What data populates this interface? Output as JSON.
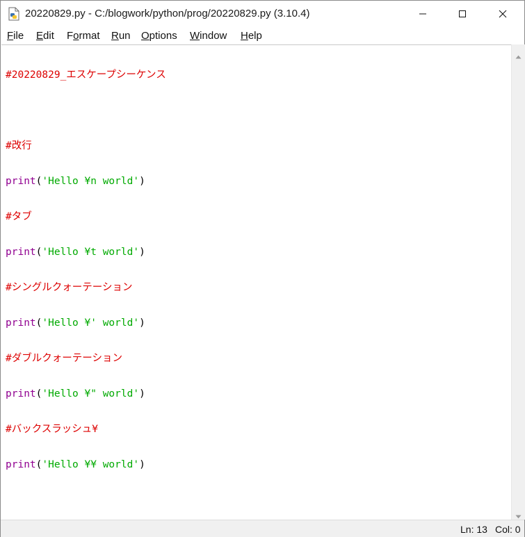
{
  "window": {
    "title": "20220829.py - C:/blogwork/python/prog/20220829.py (3.10.4)",
    "icon": "python-file-icon"
  },
  "menu": {
    "file": {
      "ul": "F",
      "rest": "ile"
    },
    "edit": {
      "ul": "E",
      "rest": "dit"
    },
    "format": {
      "pre": "F",
      "ul": "o",
      "rest": "rmat"
    },
    "run": {
      "ul": "R",
      "rest": "un"
    },
    "options": {
      "ul": "O",
      "rest": "ptions"
    },
    "window": {
      "ul": "W",
      "rest": "indow"
    },
    "help": {
      "ul": "H",
      "rest": "elp"
    }
  },
  "editor": {
    "lines": [
      {
        "comment": "#20220829_エスケープシーケンス"
      },
      {
        "blank": ""
      },
      {
        "comment": "#改行"
      },
      {
        "builtin": "print",
        "open": "(",
        "string": "'Hello ¥n world'",
        "close": ")"
      },
      {
        "comment": "#タブ"
      },
      {
        "builtin": "print",
        "open": "(",
        "string": "'Hello ¥t world'",
        "close": ")"
      },
      {
        "comment": "#シングルクォーテーション"
      },
      {
        "builtin": "print",
        "open": "(",
        "string": "'Hello ¥' world'",
        "close": ")"
      },
      {
        "comment": "#ダブルクォーテーション"
      },
      {
        "builtin": "print",
        "open": "(",
        "string": "'Hello ¥\" world'",
        "close": ")"
      },
      {
        "comment": "#バックスラッシュ¥"
      },
      {
        "builtin": "print",
        "open": "(",
        "string": "'Hello ¥¥ world'",
        "close": ")"
      }
    ]
  },
  "status": {
    "ln": "Ln: 13",
    "col": "Col: 0"
  },
  "colors": {
    "comment": "#dd0000",
    "builtin": "#900090",
    "string": "#00aa00"
  }
}
